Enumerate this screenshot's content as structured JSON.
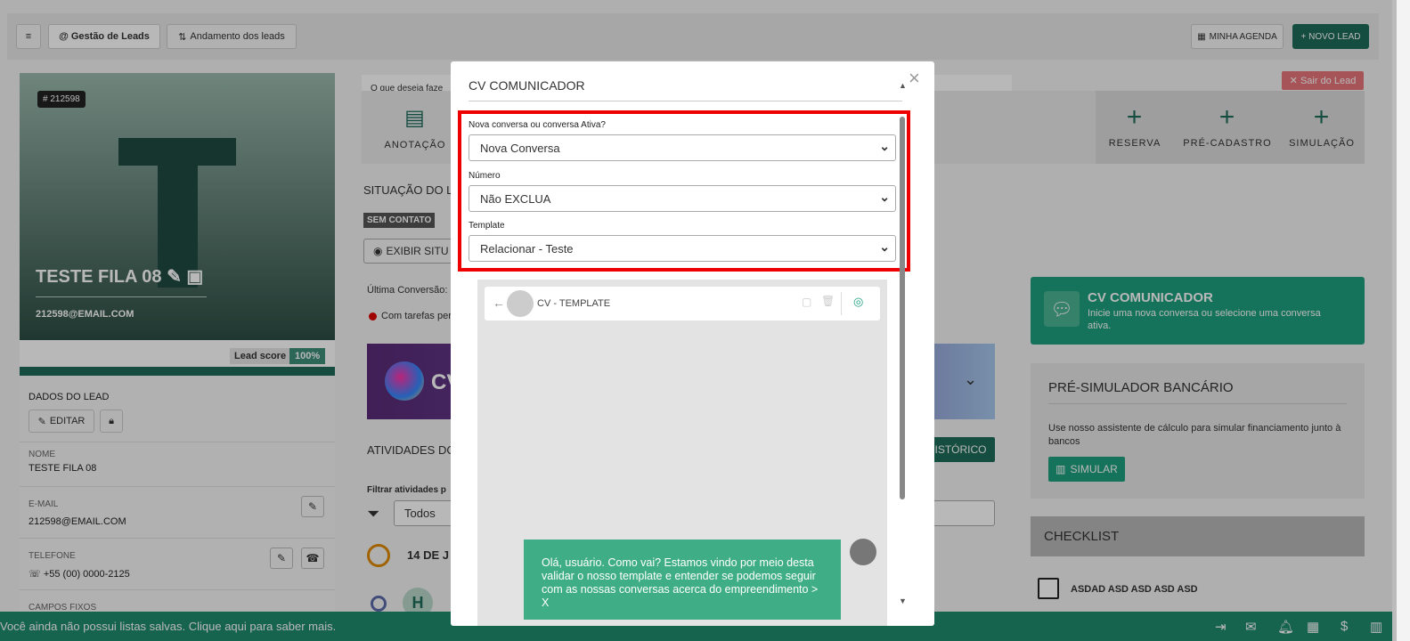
{
  "topbar": {
    "menu_icon": "hamburger-icon",
    "tab_gestao": "@ Gestão de Leads",
    "tab_andamento": "Andamento dos leads",
    "minha_agenda": "MINHA AGENDA",
    "novo_lead": "+ NOVO LEAD"
  },
  "lead": {
    "id_tag": "# 212598",
    "name": "TESTE FILA 08",
    "email": "212598@EMAIL.COM",
    "score_label": "Lead score",
    "score_value": "100%",
    "dados_title": "DADOS DO LEAD",
    "edit_label": "EDITAR",
    "fields": [
      {
        "label": "NOME",
        "value": "TESTE FILA 08"
      },
      {
        "label": "E-MAIL",
        "value": "212598@EMAIL.COM"
      },
      {
        "label": "TELEFONE",
        "value": "+55 (00) 0000-2125"
      },
      {
        "label": "CAMPOS FIXOS",
        "value": ""
      }
    ]
  },
  "main": {
    "prompt": "O que deseja faze",
    "anotacao": "ANOTAÇÃO",
    "reserva": "RESERVA",
    "pre_cadastro": "PRÉ-CADASTRO",
    "simulacao": "SIMULAÇÃO",
    "sair": "✕ Sair do Lead",
    "situacao": "SITUAÇÃO DO LE",
    "sem_contato": "SEM CONTATO",
    "exibir": "EXIBIR SITU",
    "ultima": "Última Conversão:",
    "tarefas": "Com tarefas per",
    "cv_banner": "CV",
    "atividades": "ATIVIDADES DO",
    "historico": "ISTÓRICO",
    "filtrar": "Filtrar atividades p",
    "filtro_value": "Todos",
    "date": "14 DE J",
    "timeline_avatar": "H"
  },
  "right": {
    "cv_title": "CV COMUNICADOR",
    "cv_text": "Inicie uma nova conversa ou selecione uma conversa ativa.",
    "presim_title": "PRÉ-SIMULADOR BANCÁRIO",
    "presim_text": "Use nosso assistente de cálculo para simular financiamento junto à bancos",
    "simular": "SIMULAR",
    "checklist": "CHECKLIST",
    "check_item": "ASDAD ASD ASD ASD ASD"
  },
  "status": {
    "text": "Você ainda não possui listas salvas. Clique aqui para saber mais."
  },
  "modal": {
    "title": "CV COMUNICADOR",
    "close": "×",
    "q1_label": "Nova conversa ou conversa Ativa?",
    "q1_value": "Nova Conversa",
    "q2_label": "Número",
    "q2_value": "Não EXCLUA",
    "q3_label": "Template",
    "q3_value": "Relacionar - Teste",
    "chat_title": "CV - TEMPLATE",
    "message": "Olá, usuário. Como vai? Estamos vindo por meio desta validar o nosso template e entender se podemos seguir com as nossas conversas acerca do empreendimento > X"
  }
}
